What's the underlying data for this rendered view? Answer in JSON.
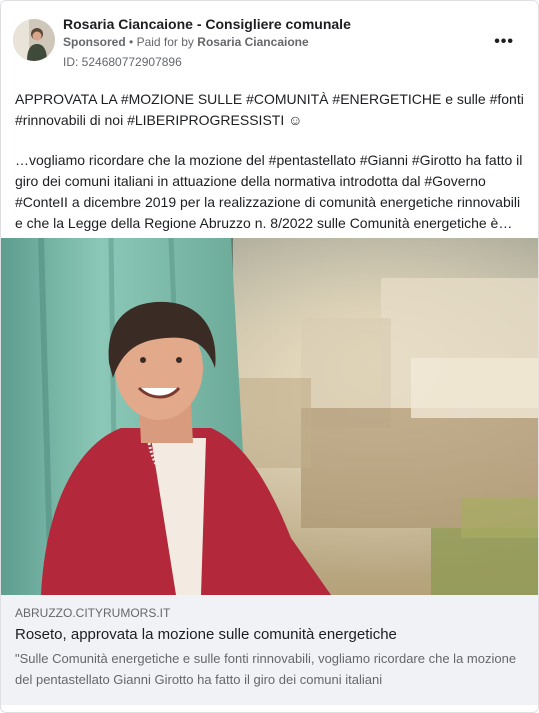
{
  "header": {
    "page_name": "Rosaria Ciancaione - Consigliere comunale",
    "sponsored_label": "Sponsored",
    "paid_for_prefix": "Paid for by",
    "paid_for_name": "Rosaria Ciancaione",
    "ad_id": "ID: 524680772907896",
    "more_icon": "more-horizontal-icon"
  },
  "post": {
    "paragraph1": "APPROVATA LA #MOZIONE SULLE #COMUNITÀ #ENERGETICHE e sulle #fonti #rinnovabili di noi #LIBERIPROGRESSISTI ☺",
    "paragraph2": "…vogliamo ricordare che la mozione del #pentastellato #Gianni #Girotto ha fatto il giro dei comuni italiani in attuazione della normativa introdotta dal #Governo #ConteII a dicembre 2019 per la realizzazione di comunità energetiche rinnovabili e che la Legge della Regione Abruzzo n. 8/2022 sulle Comunità energetiche è stata approvata"
  },
  "link_preview": {
    "domain": "ABRUZZO.CITYRUMORS.IT",
    "title": "Roseto, approvata la mozione sulle comunità energetiche",
    "description": "\"Sulle Comunità energetiche e sulle fonti rinnovabili, vogliamo ricordare che la mozione del pentastellato Gianni Girotto ha fatto il giro dei comuni italiani"
  },
  "colors": {
    "secondary_text": "#65676b",
    "link_box_bg": "#f0f2f5",
    "jacket": "#b3283a",
    "curtain": "#7fbfae"
  }
}
